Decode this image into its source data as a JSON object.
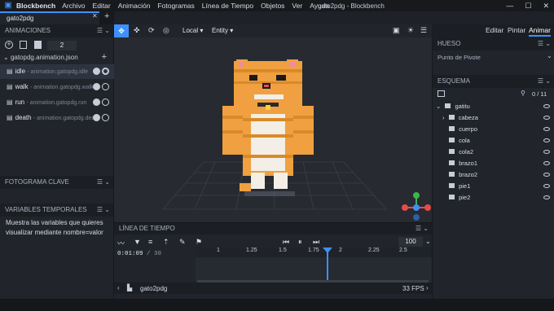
{
  "titlebar": {
    "app_name": "Blockbench",
    "menus": [
      "Archivo",
      "Editar",
      "Animación",
      "Fotogramas",
      "Línea de Tiempo",
      "Objetos",
      "Ver",
      "Ayuda"
    ],
    "window_title": "gato2pdg - Blockbench",
    "min": "—",
    "max": "☐",
    "close": "✕"
  },
  "tab": {
    "label": "gato2pdg",
    "close": "✕",
    "plus": "+"
  },
  "animations": {
    "header": "ANIMACIONES",
    "count": "2",
    "file": "gatopdg.animation.json",
    "items": [
      {
        "name": "idle",
        "file": "- animation.gatopdg.idle"
      },
      {
        "name": "walk",
        "file": "- animation.gatopdg.walk"
      },
      {
        "name": "run",
        "file": "- animation.gatopdg.run"
      },
      {
        "name": "death",
        "file": "- animation.gatopdg.death"
      }
    ]
  },
  "keyframe": {
    "header": "FOTOGRAMA CLAVE"
  },
  "variables": {
    "header": "VARIABLES TEMPORALES",
    "text": "Muestra las variables que quieres visualizar mediante nombre=valor"
  },
  "viewport_toolbar": {
    "space": "Local",
    "pivot": "Entity"
  },
  "modes": [
    "Editar",
    "Pintar",
    "Animar"
  ],
  "bone": {
    "header": "HUESO",
    "pivot_label": "Punto de Pivote"
  },
  "outliner": {
    "header": "ESQUEMA",
    "count": "0 / 11",
    "root": "gatitu",
    "items": [
      "cabeza",
      "cuerpo",
      "cola",
      "cola2",
      "brazo1",
      "brazo2",
      "pie1",
      "pie2"
    ]
  },
  "timeline": {
    "header": "LÍNEA DE TIEMPO",
    "time": "0:01:09",
    "frames": "/ 30",
    "speed": "100",
    "ticks": [
      "1",
      "1.25",
      "1.5",
      "1.75",
      "2",
      "2.25",
      "2.5"
    ],
    "model_name": "gato2pdg",
    "fps": "33 FPS"
  },
  "colors": {
    "accent": "#3e90ff",
    "panel": "#21252b",
    "viewport": "#272a30"
  }
}
